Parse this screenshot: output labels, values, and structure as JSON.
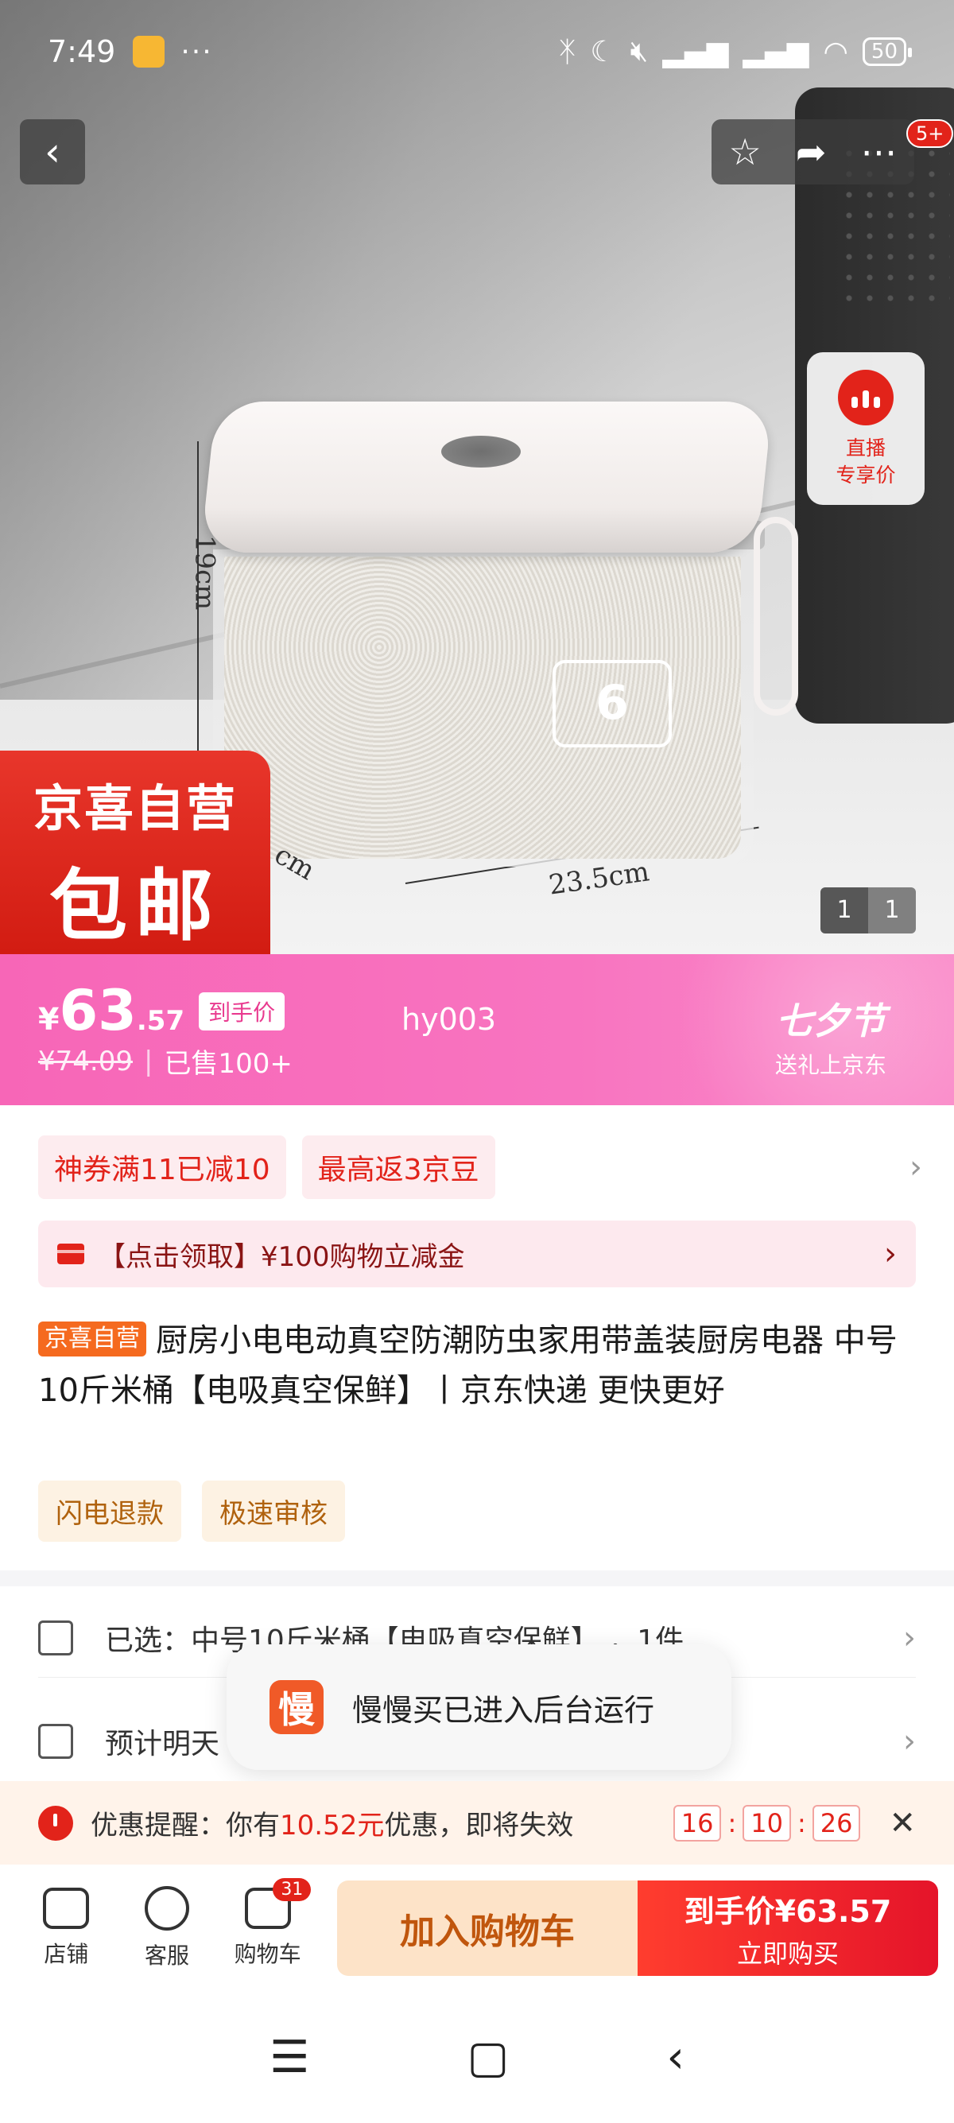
{
  "status_bar": {
    "time": "7:49",
    "dots": "···",
    "battery": "50"
  },
  "hero": {
    "dim_height": "19cm",
    "dim_width": "23.5cm",
    "dim_depth": "cm",
    "box_label": "6"
  },
  "top_actions": {
    "notification_count": "5+"
  },
  "live": {
    "line1": "直播",
    "line2": "专享价"
  },
  "promo_badge": {
    "line1": "京喜自营",
    "line2": "包邮"
  },
  "image_pager": {
    "current": "1",
    "total": "1"
  },
  "price": {
    "currency": "¥",
    "integer": "63",
    "decimal": ".57",
    "tag": "到手价",
    "original": "¥74.09",
    "sep": "|",
    "sold": "已售100+",
    "code": "hy003",
    "festival_title": "七夕节",
    "festival_sub": "送礼上京东"
  },
  "coupons": [
    "神券满11已减10",
    "最高返3京豆"
  ],
  "gift_bar": {
    "text": "【点击领取】¥100购物立减金"
  },
  "product": {
    "self_tag": "京喜自营",
    "title": "厨房小电电动真空防潮防虫家用带盖装厨房电器 中号10斤米桶【电吸真空保鲜】丨京东快递 更快更好"
  },
  "features": [
    "闪电退款",
    "极速审核"
  ],
  "rows": {
    "selected": "已选：中号10斤米桶【电吸真空保鲜】 ，1件",
    "delivery": "预计明天"
  },
  "toast": {
    "icon_char": "慢",
    "text": "慢慢买已进入后台运行"
  },
  "reminder": {
    "prefix": "优惠提醒：你有",
    "amount": "10.52元",
    "suffix": "优惠，即将失效",
    "hh": "16",
    "mm": "10",
    "ss": "26",
    "colon": ":"
  },
  "bottom_nav": {
    "store": "店铺",
    "service": "客服",
    "cart": "购物车",
    "cart_count": "31",
    "add_to_cart": "加入购物车",
    "buy_line1": "到手价¥63.57",
    "buy_line2": "立即购买"
  },
  "colors": {
    "brand_red": "#e2231a",
    "price_pink": "#f766b7"
  }
}
